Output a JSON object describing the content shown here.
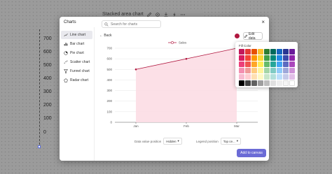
{
  "background": {
    "toolbar_title": "Stacked area chart",
    "y_ticks": [
      "700",
      "600",
      "500",
      "400",
      "300",
      "200",
      "100",
      "0"
    ]
  },
  "modal": {
    "title": "Charts",
    "close_glyph": "×",
    "sidebar": [
      {
        "label": "Line chart",
        "icon": "line-chart-icon",
        "active": true
      },
      {
        "label": "Bar chart",
        "icon": "bar-chart-icon",
        "active": false
      },
      {
        "label": "Pie chart",
        "icon": "pie-chart-icon",
        "active": false
      },
      {
        "label": "Scatter chart",
        "icon": "scatter-chart-icon",
        "active": false
      },
      {
        "label": "Funnel chart",
        "icon": "funnel-chart-icon",
        "active": false
      },
      {
        "label": "Radar chart",
        "icon": "radar-chart-icon",
        "active": false
      }
    ],
    "search_placeholder": "Search for charts",
    "back_label": "Back",
    "edit_data_label": "Edit data",
    "selected_color": "#b0173f",
    "options": {
      "data_value_position_label": "Data value position",
      "data_value_position_value": "Hidden",
      "legend_position_label": "Legend position",
      "legend_position_value": "Top ce..."
    },
    "add_button_label": "Add to canvas"
  },
  "popover": {
    "title": "Fill Color",
    "swatches": [
      "#c2185b",
      "#e53935",
      "#e65100",
      "#fbc02d",
      "#2e7d32",
      "#00695c",
      "#1565c0",
      "#283593",
      "#6a1b9a",
      "#d81b60",
      "#f44336",
      "#ff9800",
      "#fdd835",
      "#43a047",
      "#00897b",
      "#1e88e5",
      "#3949ab",
      "#8e24aa",
      "#ec407a",
      "#ef5350",
      "#ffa726",
      "#ffee58",
      "#66bb6a",
      "#26a69a",
      "#42a5f5",
      "#5c6bc0",
      "#ab47bc",
      "#f48fb1",
      "#ef9a9a",
      "#ffcc80",
      "#fff59d",
      "#a5d6a7",
      "#80cbc4",
      "#90caf9",
      "#9fa8da",
      "#ce93d8",
      "#f8bbd0",
      "#ffcdd2",
      "#ffe0b2",
      "#fff9c4",
      "#c8e6c9",
      "#b2dfdb",
      "#bbdefb",
      "#c5cae9",
      "#e1bee7",
      "#000000",
      "#424242",
      "#616161",
      "#9e9e9e",
      "#bdbdbd",
      "#e0e0e0",
      "#eeeeee",
      "#f5f5f5",
      "#ffffff"
    ]
  },
  "chart_data": {
    "type": "area",
    "categories": [
      "Jan",
      "Feb",
      "Mar"
    ],
    "series": [
      {
        "name": "Sales",
        "values": [
          500,
          600,
          700
        ],
        "color": "#b0173f"
      }
    ],
    "y_ticks": [
      0,
      100,
      200,
      300,
      400,
      500,
      600,
      700
    ],
    "ylim": [
      0,
      700
    ],
    "grid": true,
    "legend_position": "top-center"
  }
}
